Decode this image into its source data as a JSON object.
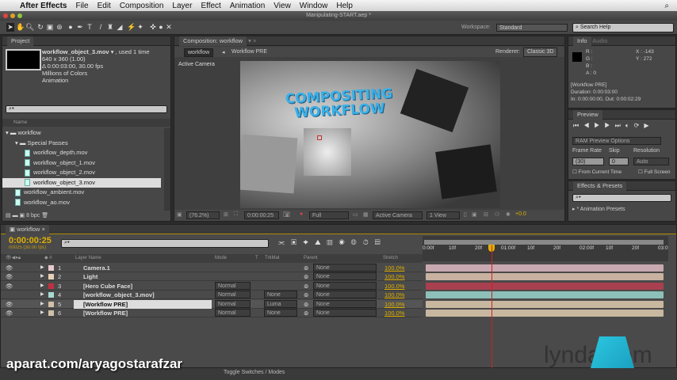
{
  "menubar": {
    "app": "After Effects",
    "items": [
      "File",
      "Edit",
      "Composition",
      "Layer",
      "Effect",
      "Animation",
      "View",
      "Window",
      "Help"
    ]
  },
  "window_title": "Manipulating-START.aep *",
  "toolbar": {
    "workspace_label": "Workspace:",
    "workspace_value": "Standard",
    "search_placeholder": "Search Help"
  },
  "project": {
    "tab": "Project",
    "file_name": "workflow_object_3.mov",
    "used": ", used 1 time",
    "info": [
      "640 x 360 (1.00)",
      "Δ 0:00:03:00, 30.00 fps",
      "Millions of Colors",
      "Animation"
    ],
    "column_name": "Name",
    "items": [
      {
        "label": "workflow",
        "type": "folder",
        "level": 0
      },
      {
        "label": "Special Passes",
        "type": "folder",
        "level": 1
      },
      {
        "label": "workflow_depth.mov",
        "type": "file",
        "level": 2
      },
      {
        "label": "workflow_object_1.mov",
        "type": "file",
        "level": 2
      },
      {
        "label": "workflow_object_2.mov",
        "type": "file",
        "level": 2
      },
      {
        "label": "workflow_object_3.mov",
        "type": "file",
        "level": 2,
        "selected": true
      },
      {
        "label": "workflow_ambient.mov",
        "type": "file",
        "level": 1
      },
      {
        "label": "workflow_ao.mov",
        "type": "file",
        "level": 1
      }
    ],
    "bpc": "8 bpc"
  },
  "composition": {
    "tab": "Composition: workflow",
    "breadcrumb": [
      "workflow",
      "Workflow PRE"
    ],
    "renderer_label": "Renderer:",
    "renderer": "Classic 3D",
    "view_label": "Active Camera",
    "title_line1": "COMPOSITING",
    "title_line2": "WORKFLOW",
    "zoom": "(76.2%)",
    "timecode": "0:00:00:25",
    "resolution": "Full",
    "camera": "Active Camera",
    "views": "1 View",
    "exposure": "+0.0"
  },
  "info": {
    "tab": "Info",
    "tab2": "Audio",
    "r": "R :",
    "g": "G :",
    "b": "B :",
    "a": "A : 0",
    "x": "X : -143",
    "y": "Y : 272",
    "layer": "[Workflow PRE]",
    "duration": "Duration: 0:00:03:00",
    "inout": "In: 0:00:00:00, Out: 0:00:02:29"
  },
  "preview": {
    "tab": "Preview",
    "ram": "RAM Preview Options",
    "frame_rate_label": "Frame Rate",
    "skip_label": "Skip",
    "resolution_label": "Resolution",
    "frame_rate": "(30)",
    "skip": "0",
    "resolution": "Auto",
    "from_current": "From Current Time",
    "full_screen": "Full Screen"
  },
  "effects": {
    "tab": "Effects & Presets",
    "item": "* Animation Presets"
  },
  "timeline": {
    "tab": "workflow",
    "timecode": "0:00:00:25",
    "fps": "00025 (30.00 fps)",
    "headers": {
      "name": "Layer Name",
      "mode": "Mode",
      "t": "T",
      "trkmat": "TrkMat",
      "parent": "Parent",
      "stretch": "Stretch"
    },
    "ruler": [
      "0:00f",
      "10f",
      "20f",
      "01:00f",
      "10f",
      "20f",
      "02:00f",
      "10f",
      "20f",
      "03:0"
    ],
    "layers": [
      {
        "num": "1",
        "name": "Camera.1",
        "color": "#e8c8d0",
        "mode": "",
        "trkmat": "",
        "parent": "None",
        "stretch": "100.0%",
        "bar": "#c9a9b1"
      },
      {
        "num": "2",
        "name": "Light",
        "color": "#e8d0b8",
        "mode": "",
        "trkmat": "",
        "parent": "None",
        "stretch": "100.0%",
        "bar": "#c9b2a0"
      },
      {
        "num": "3",
        "name": "[Hero Cube Face]",
        "color": "#c03040",
        "mode": "Normal",
        "trkmat": "",
        "parent": "None",
        "stretch": "100.0%",
        "bar": "#a8404f"
      },
      {
        "num": "4",
        "name": "[workflow_object_3.mov]",
        "color": "#a8d8d0",
        "mode": "Normal",
        "trkmat": "None",
        "parent": "None",
        "stretch": "100.0%",
        "bar": "#8cc0b8"
      },
      {
        "num": "5",
        "name": "[Workflow PRE]",
        "color": "#d0c0a8",
        "mode": "Normal",
        "trkmat": "Luma",
        "parent": "None",
        "stretch": "100.0%",
        "bar": "#c8b8a0",
        "selected": true
      },
      {
        "num": "6",
        "name": "[Workflow PRE]",
        "color": "#d0c0a8",
        "mode": "Normal",
        "trkmat": "None",
        "parent": "None",
        "stretch": "100.0%",
        "bar": "#c8b8a0"
      }
    ],
    "toggle": "Toggle Switches / Modes"
  },
  "watermark": "aparat.com/aryagostarafzar",
  "logo": "lynda.com",
  "accent": "#e0b000"
}
